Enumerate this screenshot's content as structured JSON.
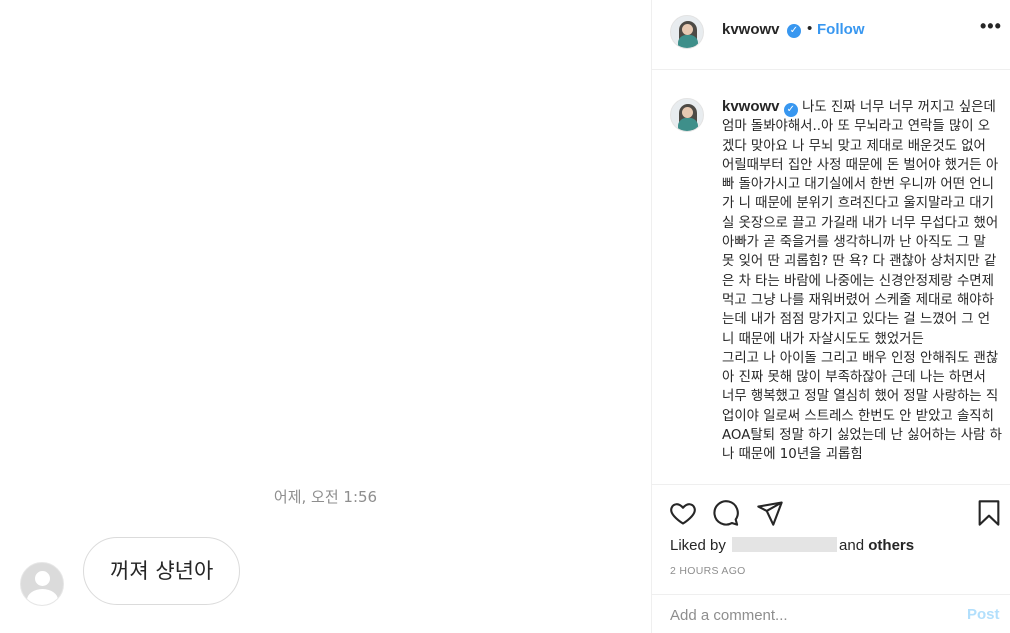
{
  "chat": {
    "timestamp": "어제, 오전 1:56",
    "message": "꺼져 샹년아"
  },
  "post": {
    "username": "kvwowv",
    "follow_label": "Follow",
    "separator": "•",
    "more_label": "•••",
    "caption_username": "kvwowv",
    "verified_glyph": "✓",
    "caption": "나도 진짜 너무 너무 꺼지고 싶은데 엄마 돌봐야해서..아 또 무뇌라고 연락들 많이 오겠다 맞아요 나 무뇌 맞고 제대로 배운것도 없어 어릴때부터 집안 사정 때문에 돈 벌어야 했거든 아빠 돌아가시고 대기실에서 한번 우니까 어떤 언니가 니 때문에 분위기 흐려진다고 울지말라고 대기실 옷장으로 끌고 가길래 내가 너무 무섭다고 했어 아빠가 곧 죽을거를 생각하니까 난 아직도 그 말 못 잊어 딴 괴롭힘? 딴 욕? 다 괜찮아 상처지만 같은 차 타는 바람에 나중에는 신경안정제랑 수면제 먹고 그냥 나를 재워버렸어 스케줄 제대로 해야하는데 내가 점점 망가지고 있다는 걸 느꼈어 그 언니 때문에 내가 자살시도도 했었거든\n그리고 나 아이돌 그리고 배우 인정 안해줘도 괜찮아 진짜 못해 많이 부족하잖아 근데 나는 하면서 너무 행복했고 정말 열심히 했어 정말 사랑하는 직업이야 일로써 스트레스 한번도 안 받았고 솔직히 AOA탈퇴 정말 하기 싫었는데 난 싫어하는 사람 하나 때문에 10년을 괴롭힘",
    "liked_prefix": "Liked by",
    "liked_suffix": "and",
    "liked_others": "others",
    "timestamp": "2 HOURS AGO",
    "comment_placeholder": "Add a comment...",
    "post_label": "Post"
  },
  "colors": {
    "accent": "#3897f0",
    "post_disabled": "#b2dffc",
    "muted": "#8e8e8e",
    "border": "#efefef"
  },
  "icons": [
    "heart-icon",
    "comment-icon",
    "share-icon",
    "bookmark-icon",
    "verified-icon",
    "more-icon",
    "avatar-placeholder-icon"
  ]
}
